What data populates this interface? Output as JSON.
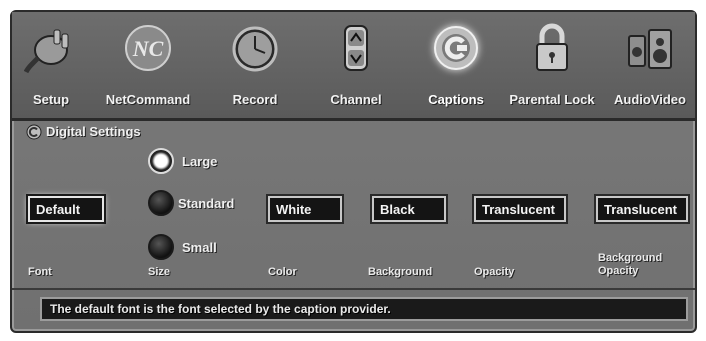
{
  "menu": {
    "items": [
      {
        "label": "Setup",
        "icon": "plug-icon"
      },
      {
        "label": "NetCommand",
        "icon": "netcommand-logo-icon"
      },
      {
        "label": "Record",
        "icon": "clock-icon"
      },
      {
        "label": "Channel",
        "icon": "channel-updown-icon"
      },
      {
        "label": "Captions",
        "icon": "captions-icon"
      },
      {
        "label": "Parental Lock",
        "icon": "padlock-icon"
      },
      {
        "label": "AudioVideo",
        "icon": "speakers-icon"
      }
    ],
    "active": "Captions"
  },
  "section": {
    "title": "Digital Settings"
  },
  "font": {
    "value": "Default",
    "label": "Font"
  },
  "size": {
    "label": "Size",
    "options": [
      "Large",
      "Standard",
      "Small"
    ],
    "selected": "Large"
  },
  "color": {
    "value": "White",
    "label": "Color"
  },
  "background": {
    "value": "Black",
    "label": "Background"
  },
  "opacity": {
    "value": "Translucent",
    "label": "Opacity"
  },
  "bg_opacity": {
    "value": "Translucent",
    "label_line1": "Background",
    "label_line2": "Opacity"
  },
  "status": {
    "text": "The default font is the font selected by the caption provider."
  }
}
